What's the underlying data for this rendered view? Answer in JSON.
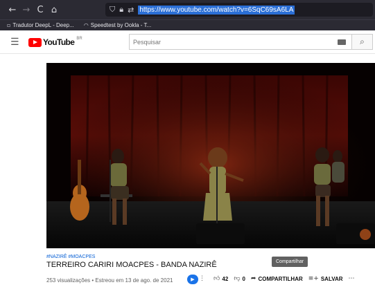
{
  "browser": {
    "back_icon": "←",
    "forward_icon": "→",
    "reload_icon": "C",
    "home_icon": "⌂",
    "url": "https://www.youtube.com/watch?v=6SqC69sA6LA"
  },
  "bookmarks": [
    {
      "label": "Tradutor DeepL - Deep..."
    },
    {
      "label": "Speedtest by Ookla - T..."
    }
  ],
  "youtube": {
    "logo_text": "YouTube",
    "region_code": "BR",
    "search_placeholder": "Pesquisar"
  },
  "video": {
    "hashtags": "#NAZIRÊ #MOACPES",
    "title": "TERREIRO CARIRI MOACPES - BANDA NAZIRÊ",
    "tooltip": "Compartilhar",
    "meta": "253 visualizações • Estreou em 13 de ago. de 2021",
    "likes": "42",
    "dislikes": "0",
    "share_label": "COMPARTILHAR",
    "save_label": "SALVAR"
  },
  "colors": {
    "accent": "#ff0000",
    "link": "#065fd4",
    "browser_bg": "#2b2a33"
  }
}
